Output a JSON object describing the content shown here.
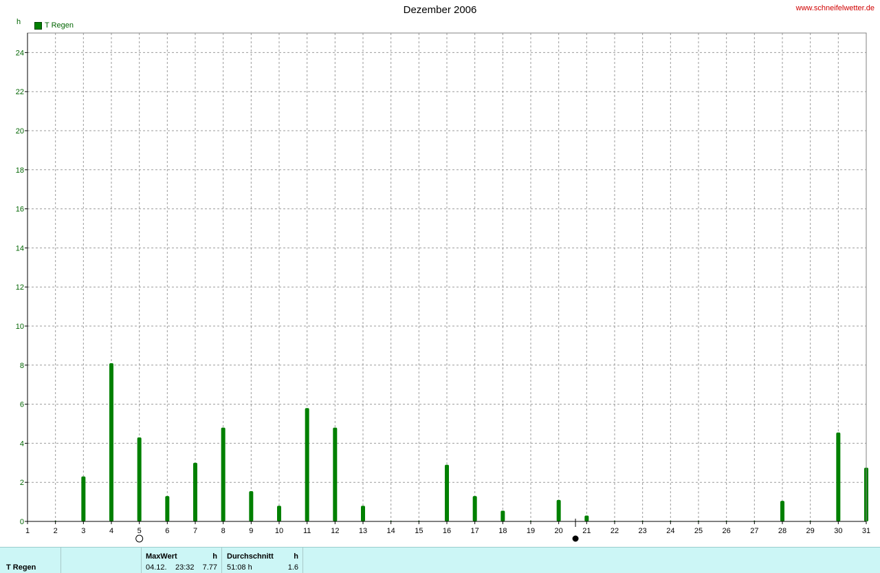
{
  "header": {
    "title": "Dezember 2006",
    "site": "www.schneifelwetter.de",
    "y_unit": "h",
    "legend_label": "T Regen"
  },
  "colors": {
    "bar": "#008000",
    "axis_label": "#006400",
    "site": "#d00000",
    "footer_bg": "#ccf6f6"
  },
  "moon_phases": [
    {
      "day": 5,
      "phase": "full-moon"
    },
    {
      "day": 20.6,
      "phase": "new-moon"
    }
  ],
  "chart_data": {
    "type": "bar",
    "title": "Dezember 2006",
    "ylabel": "h",
    "ylim": [
      0,
      25
    ],
    "yticks": [
      0,
      2,
      4,
      6,
      8,
      10,
      12,
      14,
      16,
      18,
      20,
      22,
      24
    ],
    "xlim": [
      1,
      31
    ],
    "x_ticks": [
      1,
      2,
      3,
      4,
      5,
      6,
      7,
      8,
      9,
      10,
      11,
      12,
      13,
      14,
      15,
      16,
      17,
      18,
      19,
      20,
      21,
      22,
      23,
      24,
      25,
      26,
      27,
      28,
      29,
      30,
      31
    ],
    "grid": true,
    "legend": "top-left",
    "series": [
      {
        "name": "T Regen",
        "x": [
          2,
          3,
          4,
          5,
          6,
          7,
          8,
          9,
          10,
          11,
          12,
          13,
          14,
          15,
          16,
          17,
          18,
          19,
          20,
          21,
          22,
          23,
          24,
          25,
          26,
          27,
          28,
          29,
          30,
          31
        ],
        "values": [
          0,
          2.3,
          8.1,
          4.3,
          1.3,
          3.0,
          4.8,
          1.55,
          0.8,
          5.8,
          4.8,
          0.8,
          0,
          0,
          2.9,
          1.3,
          0.55,
          0,
          1.1,
          0.3,
          0,
          0,
          0,
          0,
          0,
          0,
          1.05,
          0,
          4.55,
          2.75
        ]
      }
    ]
  },
  "footer": {
    "series_label": "T Regen",
    "max_header": "MaxWert",
    "max_unit": "h",
    "max_date": "04.12.",
    "max_time": "23:32",
    "max_value": "7.77",
    "avg_header": "Durchschnitt",
    "avg_unit": "h",
    "avg_total": "51:08 h",
    "avg_value": "1.6"
  }
}
